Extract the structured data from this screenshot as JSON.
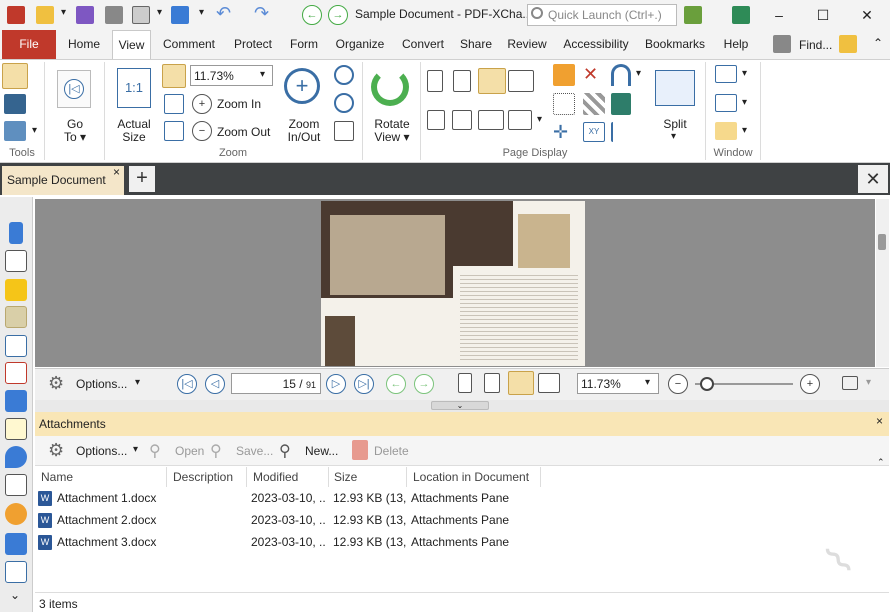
{
  "window": {
    "title": "Sample Document - PDF-XCha...",
    "quick_launch_placeholder": "Quick Launch (Ctrl+.)",
    "minimize": "–",
    "maximize": "☐",
    "close": "✕"
  },
  "ribbon_tabs": [
    "File",
    "Home",
    "View",
    "Comment",
    "Protect",
    "Form",
    "Organize",
    "Convert",
    "Share",
    "Review",
    "Accessibility",
    "Bookmarks",
    "Help"
  ],
  "find_label": "Find...",
  "ribbon": {
    "tools_group": "Tools",
    "go_to": "Go\nTo ▾",
    "go_to_line1": "Go",
    "go_to_line2": "To ▾",
    "actual_size_line1": "Actual",
    "actual_size_line2": "Size",
    "zoom_value": "11.73%",
    "zoom_in": "Zoom In",
    "zoom_out": "Zoom Out",
    "zoom_inout_line1": "Zoom",
    "zoom_inout_line2": "In/Out",
    "zoom_group": "Zoom",
    "rotate_line1": "Rotate",
    "rotate_line2": "View ▾",
    "page_display_group": "Page Display",
    "split_label": "Split",
    "window_group": "Window"
  },
  "doc_tab": {
    "label": "Sample Document",
    "close": "×",
    "add": "+"
  },
  "nav": {
    "options": "Options...",
    "page_current": "15",
    "page_total": "91",
    "zoom_value": "11.73%"
  },
  "attachments": {
    "title": "Attachments",
    "close": "×",
    "toolbar": {
      "options": "Options...",
      "open": "Open",
      "save": "Save...",
      "new": "New...",
      "delete": "Delete"
    },
    "columns": [
      "Name",
      "Description",
      "Modified",
      "Size",
      "Location in Document"
    ],
    "rows": [
      {
        "name": "Attachment 1.docx",
        "description": "",
        "modified": "2023-03-10, ..",
        "size": "12.93 KB (13,...",
        "location": "Attachments Pane"
      },
      {
        "name": "Attachment 2.docx",
        "description": "",
        "modified": "2023-03-10, ..",
        "size": "12.93 KB (13,...",
        "location": "Attachments Pane"
      },
      {
        "name": "Attachment 3.docx",
        "description": "",
        "modified": "2023-03-10, ..",
        "size": "12.93 KB (13,...",
        "location": "Attachments Pane"
      }
    ],
    "status": "3 items"
  },
  "colors": {
    "file_tab": "#c0392b",
    "doc_tab_bg": "#f4e6c9",
    "attach_header": "#f9e6b6",
    "viewer_bg": "#8d8d8d"
  },
  "icons": {
    "docx": "W"
  }
}
